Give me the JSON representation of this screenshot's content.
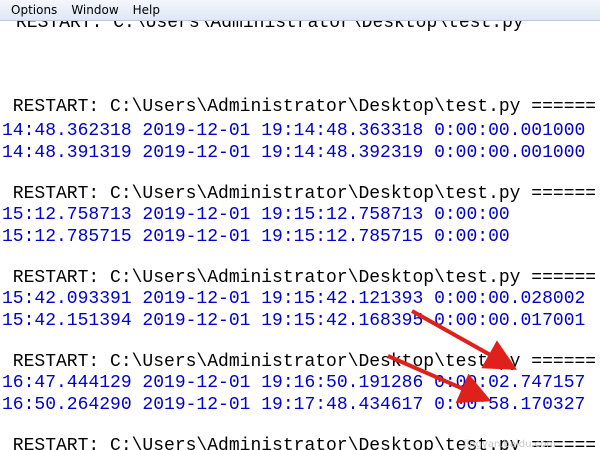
{
  "menubar": {
    "items": [
      "Options",
      "Window",
      "Help"
    ]
  },
  "shell": {
    "top_partial": "RESTART: C:\\Users\\Administrator\\Desktop\\test.py",
    "restart_line": " RESTART: C:\\Users\\Administrator\\Desktop\\test.py ======",
    "bottom_partial": " RESTART: C:\\Users\\Administrator\\Desktop\\test.py ======",
    "blocks": [
      {
        "lines": [
          "14:48.362318 2019-12-01 19:14:48.363318 0:00:00.001000",
          "14:48.391319 2019-12-01 19:14:48.392319 0:00:00.001000"
        ]
      },
      {
        "lines": [
          "15:12.758713 2019-12-01 19:15:12.758713 0:00:00",
          "15:12.785715 2019-12-01 19:15:12.785715 0:00:00"
        ]
      },
      {
        "lines": [
          "15:42.093391 2019-12-01 19:15:42.121393 0:00:00.028002",
          "15:42.151394 2019-12-01 19:15:42.168395 0:00:00.017001"
        ]
      },
      {
        "lines": [
          "16:47.444129 2019-12-01 19:16:50.191286 0:00:02.747157",
          "16:50.264290 2019-12-01 19:17:48.434617 0:00:58.170327"
        ]
      }
    ]
  },
  "annotation_color": "#e0201b",
  "watermark": "jingyan.baidu.com"
}
